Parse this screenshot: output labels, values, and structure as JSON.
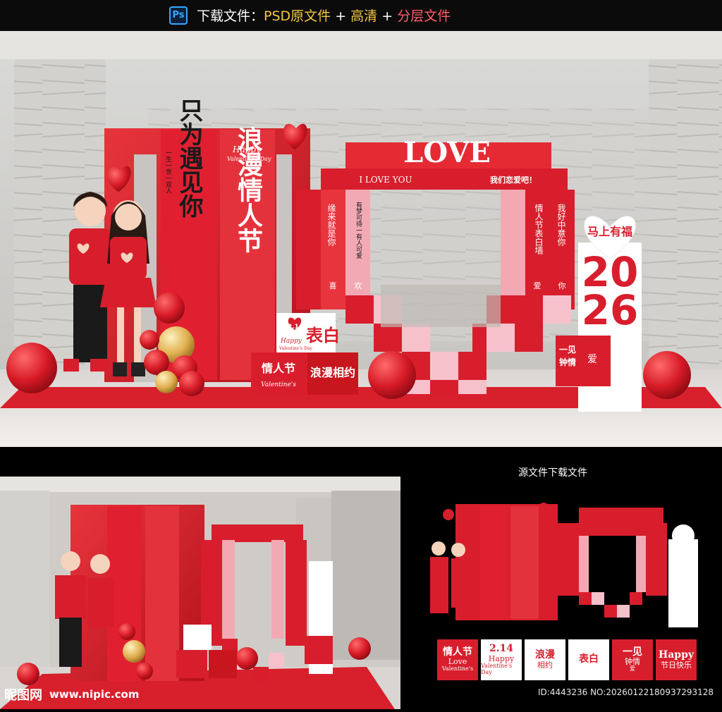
{
  "header": {
    "app_icon": "photoshop-icon",
    "app_icon_text": "Ps",
    "label": "下载文件：",
    "psd": "PSD原文件",
    "plus1": " + ",
    "hd": "高清",
    "plus2": " +  ",
    "layers": "分层文件"
  },
  "scene": {
    "vertical_banner_left": "只为遇见你",
    "vertical_banner_small": "一生一世一双人",
    "happy": "Happy",
    "valentines": "Valentine's Day",
    "vertical_banner_right": "浪漫情人节",
    "love": "LOVE",
    "i_love_you": "I LOVE YOU",
    "lets_love": "我们恋爱吧！",
    "col1": "缘来就是你",
    "col2": "有梦可待一有人可爱",
    "col3": "情人节表白墙",
    "col4": "我好中意你",
    "xi": "喜",
    "huan": "欢",
    "ai": "爱",
    "ni": "你",
    "year_top": "20",
    "year_bottom": "26",
    "heart_text": "马上有福",
    "date": "2.14",
    "box_happy": "Happy",
    "box_vday": "Valentine's Day",
    "box1_big": "情人节",
    "box1_small": "Valentine's",
    "box2": "浪漫相约",
    "box3": "表白",
    "box4_a": "一见",
    "box4_b": "钟情",
    "box4_c": "爱"
  },
  "overview_label": "源文件下载文件",
  "id_text": "ID:4443236 NO:20260122180937293128",
  "watermark": {
    "cn": "昵图网",
    "url": "www.nipic.com"
  },
  "thumbs": [
    {
      "name": "thumb-qingrenjie",
      "line1": "情人节",
      "line2": "Love",
      "line3": "Valentine's"
    },
    {
      "name": "thumb-214",
      "line1": "2.14",
      "line2": "Happy",
      "line3": "Valentine's Day"
    },
    {
      "name": "thumb-langman",
      "line1": "浪漫",
      "line2": "相约",
      "line3": ""
    },
    {
      "name": "thumb-biaobai",
      "line1": "表白",
      "line2": "",
      "line3": ""
    },
    {
      "name": "thumb-yijian",
      "line1": "一见",
      "line2": "钟情",
      "line3": "爱"
    },
    {
      "name": "thumb-happy",
      "line1": "Happy",
      "line2": "节日快乐",
      "line3": ""
    }
  ],
  "colors": {
    "red": "#d81e2c",
    "deep_red": "#a90f1c",
    "pink": "#f7c1cc",
    "gold": "#f0c060",
    "floor": "#e8e3e0"
  }
}
